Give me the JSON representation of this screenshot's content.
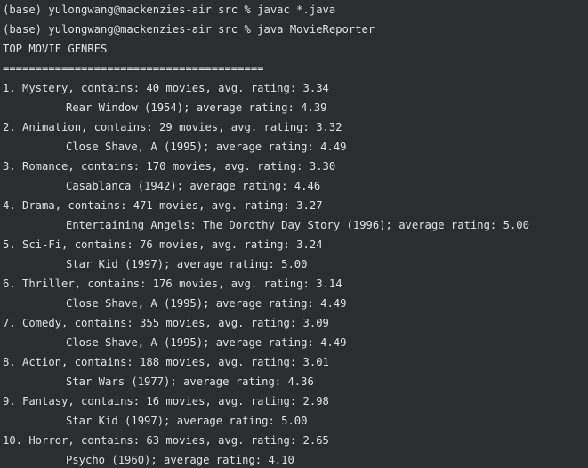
{
  "terminal": {
    "lines": [
      {
        "text": "(base) yulongwang@mackenzies-air src % javac *.java"
      },
      {
        "text": "(base) yulongwang@mackenzies-air src % java MovieReporter"
      },
      {
        "text": "TOP MOVIE GENRES"
      },
      {
        "text": "========================================"
      },
      {
        "text": "1. Mystery, contains: 40 movies, avg. rating: 3.34"
      },
      {
        "text": "Rear Window (1954); average rating: 4.39"
      },
      {
        "text": "2. Animation, contains: 29 movies, avg. rating: 3.32"
      },
      {
        "text": "Close Shave, A (1995); average rating: 4.49"
      },
      {
        "text": "3. Romance, contains: 170 movies, avg. rating: 3.30"
      },
      {
        "text": "Casablanca (1942); average rating: 4.46"
      },
      {
        "text": "4. Drama, contains: 471 movies, avg. rating: 3.27"
      },
      {
        "text": "Entertaining Angels: The Dorothy Day Story (1996); average rating: 5.00"
      },
      {
        "text": "5. Sci-Fi, contains: 76 movies, avg. rating: 3.24"
      },
      {
        "text": "Star Kid (1997); average rating: 5.00"
      },
      {
        "text": "6. Thriller, contains: 176 movies, avg. rating: 3.14"
      },
      {
        "text": "Close Shave, A (1995); average rating: 4.49"
      },
      {
        "text": "7. Comedy, contains: 355 movies, avg. rating: 3.09"
      },
      {
        "text": "Close Shave, A (1995); average rating: 4.49"
      },
      {
        "text": "8. Action, contains: 188 movies, avg. rating: 3.01"
      },
      {
        "text": "Star Wars (1977); average rating: 4.36"
      },
      {
        "text": "9. Fantasy, contains: 16 movies, avg. rating: 2.98"
      },
      {
        "text": "Star Kid (1997); average rating: 5.00"
      },
      {
        "text": "10. Horror, contains: 63 movies, avg. rating: 2.65"
      },
      {
        "text": "Psycho (1960); average rating: 4.10"
      }
    ]
  }
}
